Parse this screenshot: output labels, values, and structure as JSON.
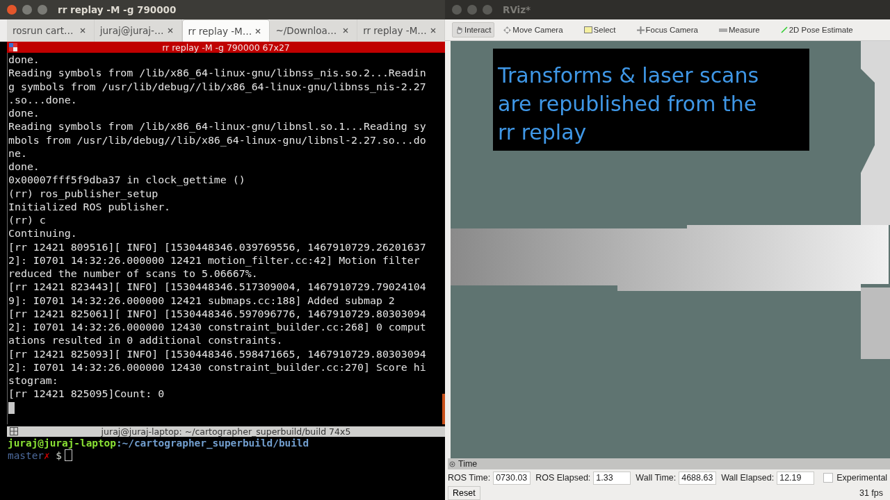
{
  "terminal_window": {
    "title": "rr replay -M -g 790000",
    "tabs": [
      {
        "label": "rosrun cart…",
        "selected": false
      },
      {
        "label": "juraj@juraj-…",
        "selected": false
      },
      {
        "label": "rr replay -M…",
        "selected": true
      },
      {
        "label": "~/Downloa…",
        "selected": false
      },
      {
        "label": "rr replay -M…",
        "selected": false
      }
    ],
    "pane_title": "rr replay -M -g 790000 67x27",
    "lines": [
      "done.",
      "Reading symbols from /lib/x86_64-linux-gnu/libnss_nis.so.2...Readin",
      "g symbols from /usr/lib/debug//lib/x86_64-linux-gnu/libnss_nis-2.27",
      ".so...done.",
      "done.",
      "Reading symbols from /lib/x86_64-linux-gnu/libnsl.so.1...Reading sy",
      "mbols from /usr/lib/debug//lib/x86_64-linux-gnu/libnsl-2.27.so...do",
      "ne.",
      "done.",
      "0x00007fff5f9dba37 in clock_gettime ()",
      "(rr) ros_publisher_setup",
      "Initialized ROS publisher.",
      "(rr) c",
      "Continuing.",
      "[rr 12421 809516][ INFO] [1530448346.039769556, 1467910729.26201637",
      "2]: I0701 14:32:26.000000 12421 motion_filter.cc:42] Motion filter",
      "reduced the number of scans to 5.06667%.",
      "[rr 12421 823443][ INFO] [1530448346.517309004, 1467910729.79024104",
      "9]: I0701 14:32:26.000000 12421 submaps.cc:188] Added submap 2",
      "[rr 12421 825061][ INFO] [1530448346.597096776, 1467910729.80303094",
      "2]: I0701 14:32:26.000000 12430 constraint_builder.cc:268] 0 comput",
      "ations resulted in 0 additional constraints.",
      "[rr 12421 825093][ INFO] [1530448346.598471665, 1467910729.80303094",
      "2]: I0701 14:32:26.000000 12430 constraint_builder.cc:270] Score hi",
      "stogram:",
      "[rr 12421 825095]Count: 0"
    ],
    "bottom_pane": {
      "title": "juraj@juraj-laptop: ~/cartographer_superbuild/build 74x5",
      "user": "juraj@juraj-laptop",
      "path": ":~/cartographer_superbuild/build",
      "branch": "master",
      "dirty_mark": "✗",
      "prompt": "$"
    }
  },
  "rviz_window": {
    "title": "RViz*",
    "tools": [
      {
        "label": "Interact",
        "selected": true,
        "kind": "hand"
      },
      {
        "label": "Move Camera",
        "selected": false,
        "kind": "move"
      },
      {
        "label": "Select",
        "selected": false,
        "kind": "select"
      },
      {
        "label": "Focus Camera",
        "selected": false,
        "kind": "focus"
      },
      {
        "label": "Measure",
        "selected": false,
        "kind": "measure"
      },
      {
        "label": "2D Pose Estimate",
        "selected": false,
        "kind": "pose"
      }
    ],
    "caption": "Transforms & laser scans are republished from the rr replay",
    "time_panel": {
      "title": "Time",
      "fields": [
        {
          "label": "ROS Time:",
          "value": "0730.03"
        },
        {
          "label": "ROS Elapsed:",
          "value": "1.33"
        },
        {
          "label": "Wall Time:",
          "value": "4688.63"
        },
        {
          "label": "Wall Elapsed:",
          "value": "12.19"
        }
      ],
      "experimental": {
        "label": "Experimental",
        "checked": false
      },
      "reset": "Reset",
      "fps": "31 fps"
    }
  }
}
